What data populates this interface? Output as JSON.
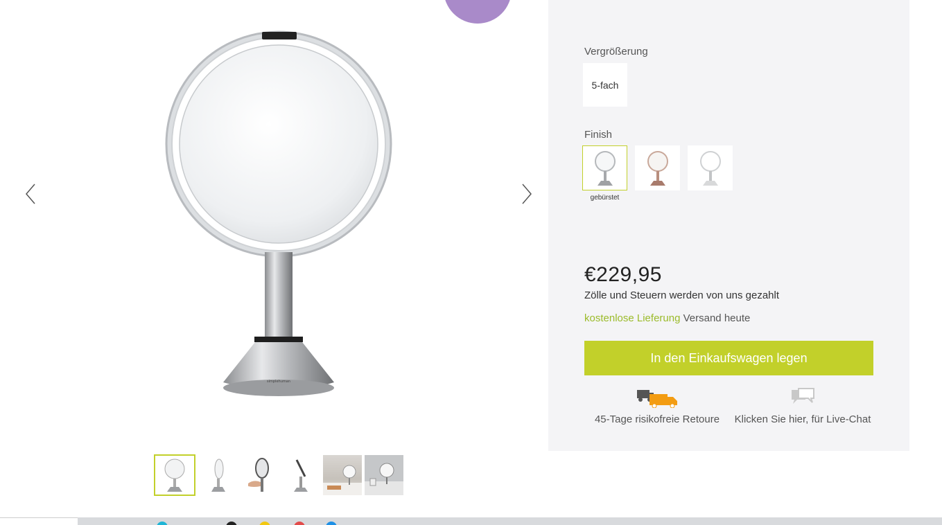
{
  "product": {
    "magnification_label": "Vergrößerung",
    "magnification_option": "5-fach",
    "finish_label": "Finish",
    "finish_selected_caption": "gebürstet",
    "finish_options": [
      "brushed",
      "rose-gold",
      "white"
    ],
    "price": "€229,95",
    "duty_note": "Zölle und Steuern werden von uns gezahlt",
    "shipping_free": "kostenlose Lieferung",
    "shipping_today": "Versand heute",
    "add_to_cart": "In den Einkaufswagen legen",
    "perks": {
      "returns": "45-Tage risikofreie Retoure",
      "chat": "Klicken Sie hier, für Live-Chat"
    }
  },
  "gallery": {
    "icons": [
      "chevron-left-icon",
      "chevron-right-icon"
    ],
    "thumbnail_count": 6,
    "active_thumbnail": 1,
    "product_logo_text": "simplehuman"
  },
  "colors": {
    "accent": "#c2d02a",
    "free_shipping_text": "#9bbb2a",
    "panel_bg": "#f4f4f6",
    "badge": "#a98ac9",
    "truck": "#f39c12"
  }
}
